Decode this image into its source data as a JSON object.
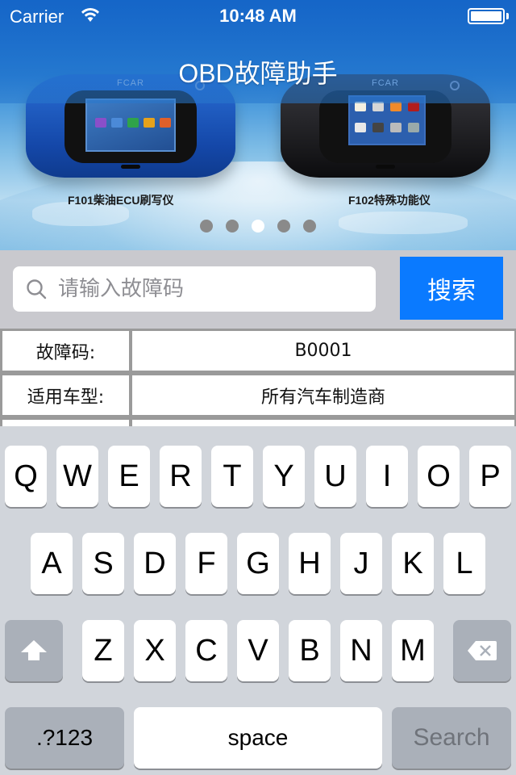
{
  "status_bar": {
    "carrier": "Carrier",
    "time": "10:48 AM",
    "wifi_icon": "wifi-icon",
    "battery_icon": "battery-full-icon",
    "battery_level": 1.0
  },
  "app": {
    "title": "OBD故障助手"
  },
  "banner": {
    "products": [
      {
        "label": "F101柴油ECU刷写仪",
        "brand": "FCAR",
        "color": "blue"
      },
      {
        "label": "F102特殊功能仪",
        "brand": "FCAR",
        "color": "black"
      }
    ],
    "page_count": 5,
    "active_page": 3
  },
  "search": {
    "placeholder": "请输入故障码",
    "value": "",
    "icon": "search-icon",
    "button_label": "搜索",
    "button_color": "#0a7aff"
  },
  "results": {
    "rows": [
      {
        "label": "故障码:",
        "value": "B0001"
      },
      {
        "label": "适用车型:",
        "value": "所有汽车制造商"
      }
    ]
  },
  "keyboard": {
    "row1": [
      "Q",
      "W",
      "E",
      "R",
      "T",
      "Y",
      "U",
      "I",
      "O",
      "P"
    ],
    "row2": [
      "A",
      "S",
      "D",
      "F",
      "G",
      "H",
      "J",
      "K",
      "L"
    ],
    "row3": [
      "Z",
      "X",
      "C",
      "V",
      "B",
      "N",
      "M"
    ],
    "shift_icon": "shift-icon",
    "delete_icon": "backspace-icon",
    "numbers_label": ".?123",
    "space_label": "space",
    "return_label": "Search"
  }
}
